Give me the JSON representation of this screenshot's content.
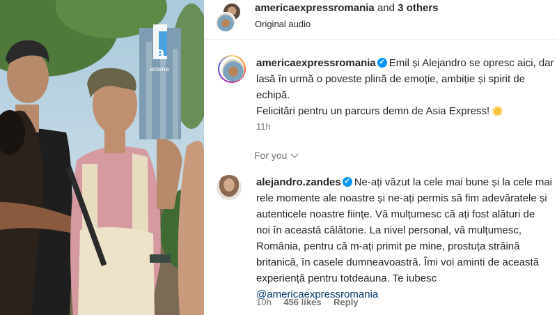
{
  "header": {
    "account": "americaexpressromania",
    "joiner": " and ",
    "others": "3 others",
    "audio": "Original audio"
  },
  "caption": {
    "username": "americaexpressromania",
    "lines": [
      "Emil și Alejandro se opresc aici, dar",
      "lasă în urmă o poveste plină de emoție, ambiție și spirit de",
      "echipă.",
      "Felicitări pentru un parcurs demn de Asia Express!"
    ],
    "time": "11h"
  },
  "section": {
    "for_you": "For you"
  },
  "comment": {
    "username": "alejandro.zandes",
    "lines": [
      "Ne-ați văzut la cele mai bune și la cele mai",
      "rele momente ale noastre și ne-ați permis să fim adevăratele și",
      "autenticele noastre ființe. Vă mulțumesc că ați fost alături de",
      "noi în această călătorie. La nivel personal, vă mulțumesc,",
      "România, pentru că m-ați primit pe mine, prostuța străină",
      "britanică, în casele dumneavoastră. Îmi voi aminti de această",
      "experiență pentru totdeauna. Te iubesc"
    ],
    "mention": "@americaexpressromania",
    "time": "10h",
    "likes": "456 likes",
    "reply": "Reply"
  },
  "media": {
    "channel_logo_text": "antena",
    "channel_logo_letter": "a"
  },
  "icons": {
    "verified": "verified-badge-icon",
    "sun": "sun-emoji-icon",
    "chevron": "chevron-down-icon"
  },
  "colors": {
    "verified": "#0095f6",
    "text": "#262626",
    "muted": "#737373",
    "mention": "#00376b"
  }
}
